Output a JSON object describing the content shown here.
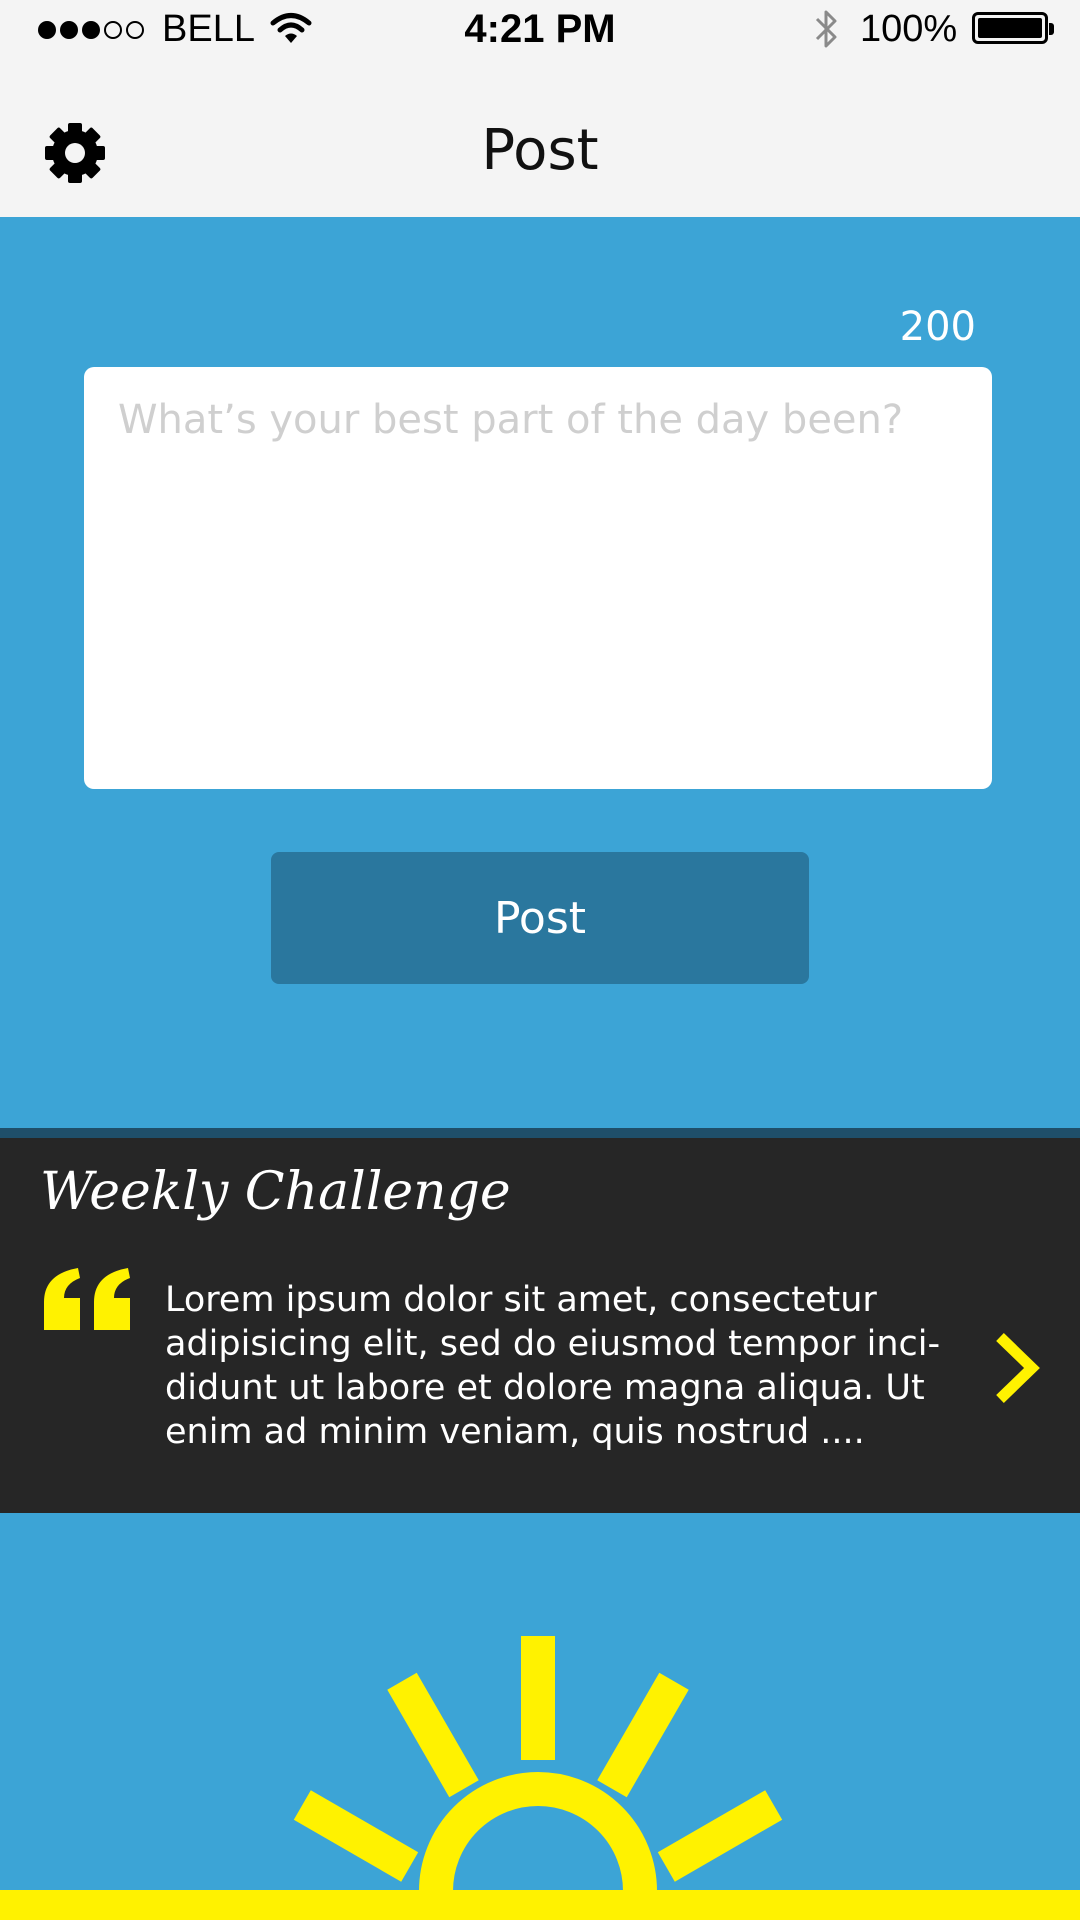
{
  "status_bar": {
    "carrier": "BELL",
    "time": "4:21 PM",
    "battery_percent": "100%",
    "signal_bars_filled": 3,
    "signal_bars_total": 5,
    "battery_level": 1.0
  },
  "nav": {
    "title": "Post",
    "settings_icon": "gear-icon"
  },
  "composer": {
    "char_remaining": "200",
    "placeholder": "What’s your best part of the day been?",
    "value": "",
    "submit_label": "Post"
  },
  "challenge": {
    "title": "Weekly Challenge",
    "text": "Lorem ipsum dolor sit amet, consectetur adipisicing elit, sed do eiusmod tempor inci-didunt ut labore et dolore magna aliqua. Ut enim ad minim veniam, quis nostrud ....",
    "quote_icon": "quote-icon",
    "next_icon": "chevron-right-icon"
  },
  "colors": {
    "background_blue": "#3CA4D6",
    "button_blue": "#2A779E",
    "bar_gray": "#F4F4F4",
    "panel_dark": "#262626",
    "accent_yellow": "#FFF200"
  }
}
